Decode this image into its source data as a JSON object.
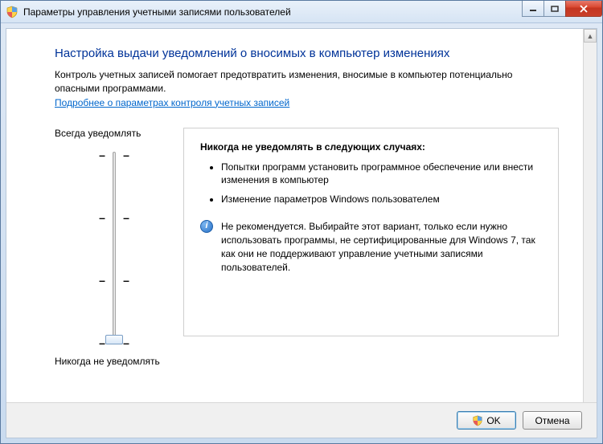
{
  "window": {
    "title": "Параметры управления учетными записями пользователей"
  },
  "page": {
    "heading": "Настройка выдачи уведомлений о вносимых в компьютер изменениях",
    "intro": "Контроль учетных записей помогает предотвратить изменения, вносимые в компьютер потенциально опасными программами.",
    "learn_more": "Подробнее о параметрах контроля учетных записей"
  },
  "slider": {
    "top_label": "Всегда уведомлять",
    "bottom_label": "Никогда не уведомлять",
    "levels": 4,
    "current_level": 0
  },
  "panel": {
    "title": "Никогда не уведомлять в следующих случаях:",
    "bullets": [
      "Попытки программ установить программное обеспечение или внести изменения в компьютер",
      "Изменение параметров Windows пользователем"
    ],
    "recommendation": "Не рекомендуется. Выбирайте этот вариант, только если нужно использовать программы, не сертифицированные для Windows 7, так как они не поддерживают управление учетными записями пользователей."
  },
  "buttons": {
    "ok": "OK",
    "cancel": "Отмена"
  }
}
